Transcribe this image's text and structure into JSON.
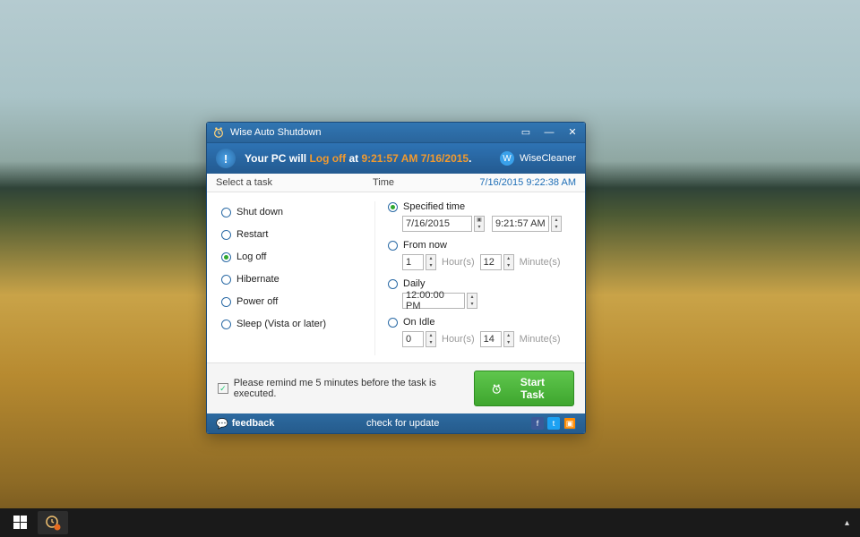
{
  "titlebar": {
    "title": "Wise Auto Shutdown"
  },
  "banner": {
    "prefix": "Your PC will ",
    "action": "Log off",
    "mid": " at ",
    "time": "9:21:57 AM 7/16/2015",
    "suffix": ".",
    "brand": "WiseCleaner"
  },
  "columns": {
    "task": "Select a task",
    "time": "Time",
    "datetime": "7/16/2015 9:22:38 AM"
  },
  "tasks": {
    "shutdown": "Shut down",
    "restart": "Restart",
    "logoff": "Log off",
    "hibernate": "Hibernate",
    "poweroff": "Power off",
    "sleep": "Sleep (Vista or later)"
  },
  "time_opts": {
    "specified": {
      "label": "Specified time",
      "date": "7/16/2015",
      "clock": "9:21:57 AM"
    },
    "fromnow": {
      "label": "From now",
      "hours": "1",
      "hours_lbl": "Hour(s)",
      "minutes": "12",
      "minutes_lbl": "Minute(s)"
    },
    "daily": {
      "label": "Daily",
      "clock": "12:00:00 PM"
    },
    "idle": {
      "label": "On Idle",
      "hours": "0",
      "hours_lbl": "Hour(s)",
      "minutes": "14",
      "minutes_lbl": "Minute(s)"
    }
  },
  "action": {
    "remind": "Please remind me 5 minutes before the task is executed.",
    "start": "Start Task"
  },
  "footer": {
    "feedback": "feedback",
    "update": "check for update"
  }
}
